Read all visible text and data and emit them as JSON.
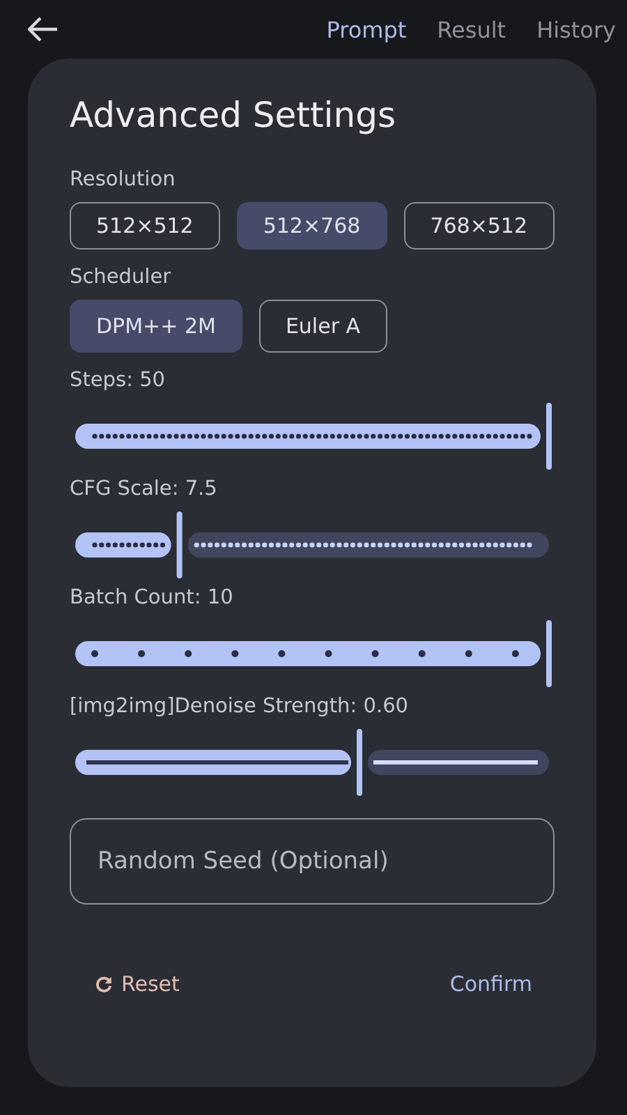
{
  "top_bar": {
    "tabs": [
      {
        "label": "Prompt",
        "selected": true
      },
      {
        "label": "Result",
        "selected": false
      },
      {
        "label": "History",
        "selected": false
      }
    ]
  },
  "dialog": {
    "title": "Advanced Settings",
    "resolution": {
      "label": "Resolution",
      "options": [
        {
          "label": "512×512",
          "selected": false
        },
        {
          "label": "512×768",
          "selected": true
        },
        {
          "label": "768×512",
          "selected": false
        }
      ]
    },
    "scheduler": {
      "label": "Scheduler",
      "options": [
        {
          "label": "DPM++ 2M",
          "selected": true
        },
        {
          "label": "Euler A",
          "selected": false
        }
      ]
    },
    "sliders": [
      {
        "label": "Steps: 50",
        "level": 1,
        "kind": "dense"
      },
      {
        "label": "CFG Scale: 7.5",
        "level": 0.22,
        "kind": "dense"
      },
      {
        "label": "Batch Count: 10",
        "level": 1,
        "kind": "sparse"
      },
      {
        "label": "[img2img]Denoise Strength: 0.60",
        "level": 0.6,
        "kind": "continuous"
      }
    ],
    "seed_field": {
      "placeholder": "Random Seed (Optional)"
    },
    "buttons": [
      {
        "label": "Reset",
        "kind": "reset"
      },
      {
        "label": "Confirm",
        "kind": "confirm"
      }
    ]
  }
}
